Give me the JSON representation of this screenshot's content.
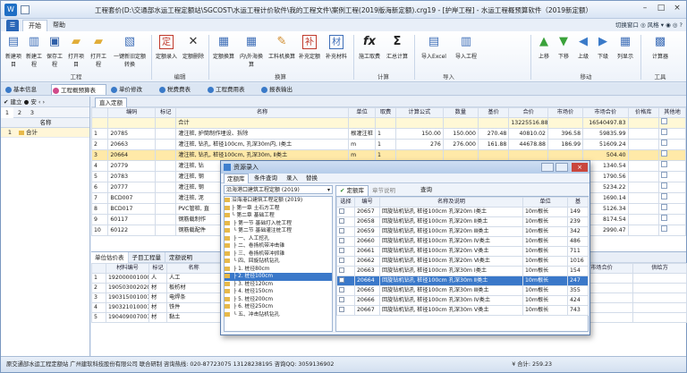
{
  "window": {
    "title": "工程套价(D:\\交通部水运工程定额站\\SGCOST\\水运工程计价软件\\我的工程文件\\案例工程(2019版海新定额).crg19 - [护岸工程] - 水运工程概预算软件（2019新定额）",
    "minimize": "–",
    "maximize": "□",
    "close": "×"
  },
  "menu": {
    "file": "☰",
    "tabs": [
      "开始",
      "帮助"
    ],
    "right": "切换窗口 ◎ 风格 ▾ ◉ ◎ ?"
  },
  "ribbon": {
    "groups": [
      {
        "label": "工程",
        "buttons": [
          "新建项目",
          "新建工程",
          "保存工程",
          "打开项目",
          "打开工程",
          "一键新旧定额转换"
        ]
      },
      {
        "label": "编辑",
        "buttons": [
          "定额录入",
          "定额删除"
        ]
      },
      {
        "label": "换算",
        "buttons": [
          "定额换算",
          "内\\外海换算",
          "工料机换算",
          "补充定额",
          "补充材料"
        ]
      },
      {
        "label": "计算",
        "buttons": [
          "施工取费",
          "汇总计算"
        ]
      },
      {
        "label": "导入",
        "buttons": [
          "导入Excel",
          "导入工程"
        ]
      },
      {
        "label": "移动",
        "buttons": [
          "上移",
          "下移",
          "上级",
          "下级",
          "列显示"
        ]
      },
      {
        "label": "工具",
        "buttons": [
          "计算器"
        ]
      }
    ]
  },
  "subtabs": [
    "基本信息",
    "工程概预算表",
    "单价修改",
    "税费费表",
    "工程费用表",
    "报表输出"
  ],
  "leftpane": {
    "toolbar": "✔ 建立  ● 安 ‹ ›",
    "level_tabs": [
      "1",
      "2",
      "3"
    ],
    "header": [
      "",
      "名称"
    ],
    "rows": [
      {
        "no": "1",
        "name": "合计"
      }
    ]
  },
  "maintable": {
    "tab": "直入定额",
    "headers": [
      "",
      "编码",
      "标记",
      "名称",
      "单位",
      "取费",
      "计算公式",
      "数量",
      "基价",
      "合价",
      "市场价",
      "市场合价",
      "价格库",
      "其他地"
    ],
    "rows": [
      {
        "no": "",
        "code": "",
        "mark": "",
        "name": "合计",
        "unit": "",
        "fee": "",
        "formula": "",
        "qty": "",
        "base": "",
        "total": "13225516.88",
        "market": "",
        "mtotal": "16540497.83",
        "lib": "",
        "cls": "hl"
      },
      {
        "no": "1",
        "code": "20785",
        "mark": "",
        "name": "灌注桩, 护筒制作埋设、拆除",
        "unit": "根灌注桩",
        "fee": "1",
        "formula": "150.00",
        "qty": "150.000",
        "base": "270.48",
        "total": "40810.02",
        "market": "396.58",
        "mtotal": "59835.99",
        "lib": "",
        "cls": ""
      },
      {
        "no": "2",
        "code": "20663",
        "mark": "",
        "name": "灌注桩, 钻孔, 桩径100cm, 孔深30m内, Ⅰ类土",
        "unit": "m",
        "fee": "1",
        "formula": "276",
        "qty": "276.000",
        "base": "161.88",
        "total": "44678.88",
        "market": "186.99",
        "mtotal": "51609.24",
        "lib": "",
        "cls": ""
      },
      {
        "no": "3",
        "code": "20664",
        "mark": "",
        "name": "灌注桩, 钻孔, 桩径100cm, 孔深30m, Ⅱ类土",
        "unit": "m",
        "fee": "1",
        "formula": "",
        "qty": "",
        "base": "",
        "total": "",
        "market": "",
        "mtotal": "504.40",
        "lib": "",
        "cls": "sel"
      },
      {
        "no": "4",
        "code": "20779",
        "mark": "",
        "name": "灌注桩, 钻",
        "unit": "",
        "fee": "",
        "formula": "",
        "qty": "",
        "base": "",
        "total": "",
        "market": "",
        "mtotal": "1340.54",
        "lib": "",
        "cls": ""
      },
      {
        "no": "5",
        "code": "20783",
        "mark": "",
        "name": "灌注桩, 钢",
        "unit": "",
        "fee": "",
        "formula": "",
        "qty": "",
        "base": "",
        "total": "",
        "market": "",
        "mtotal": "1790.56",
        "lib": "",
        "cls": ""
      },
      {
        "no": "6",
        "code": "20777",
        "mark": "",
        "name": "灌注桩, 钢",
        "unit": "",
        "fee": "",
        "formula": "",
        "qty": "",
        "base": "",
        "total": "",
        "market": "",
        "mtotal": "5234.22",
        "lib": "",
        "cls": ""
      },
      {
        "no": "7",
        "code": "BCD007",
        "mark": "",
        "name": "灌注桩, 泥",
        "unit": "",
        "fee": "",
        "formula": "",
        "qty": "",
        "base": "",
        "total": "",
        "market": "",
        "mtotal": "1690.14",
        "lib": "",
        "cls": ""
      },
      {
        "no": "8",
        "code": "BCD017",
        "mark": "",
        "name": "PVC管桩, 直",
        "unit": "",
        "fee": "",
        "formula": "",
        "qty": "",
        "base": "",
        "total": "",
        "market": "",
        "mtotal": "5126.34",
        "lib": "",
        "cls": ""
      },
      {
        "no": "9",
        "code": "60117",
        "mark": "",
        "name": "钢筋载制作",
        "unit": "",
        "fee": "",
        "formula": "",
        "qty": "",
        "base": "",
        "total": "",
        "market": "",
        "mtotal": "8174.54",
        "lib": "",
        "cls": ""
      },
      {
        "no": "10",
        "code": "60122",
        "mark": "",
        "name": "钢筋载配件",
        "unit": "",
        "fee": "",
        "formula": "",
        "qty": "",
        "base": "",
        "total": "",
        "market": "",
        "mtotal": "2990.47",
        "lib": "",
        "cls": ""
      }
    ]
  },
  "lowertable": {
    "tabs": [
      "单位估价表",
      "子目工程量",
      "定额说明"
    ],
    "headers": [
      "",
      "材料编号",
      "标记",
      "名称"
    ],
    "right_headers": [
      "市场合价",
      "供给方"
    ],
    "right_sub": "合价",
    "rows": [
      {
        "no": "1",
        "code": "192000001000",
        "mark": "人",
        "name": "人工"
      },
      {
        "no": "2",
        "code": "190503002020",
        "mark": "材",
        "name": "板枋材"
      },
      {
        "no": "3",
        "code": "190315001001",
        "mark": "材",
        "name": "电焊条"
      },
      {
        "no": "4",
        "code": "190321010001",
        "mark": "材",
        "name": "铁件"
      },
      {
        "no": "5",
        "code": "190409007001",
        "mark": "材",
        "name": "黏土"
      }
    ]
  },
  "dialog": {
    "title": "资源录入",
    "tabs": [
      "定额库",
      "条件查询",
      "录入",
      "替换"
    ],
    "library": "沿海港口建筑工程定额 (2019)",
    "right_tabs": [
      "定额库",
      "章节说明"
    ],
    "search_label": "查询",
    "tree": [
      "沿海港口建筑工程定额 (2019)",
      "├ 第一章 土石方工程",
      "└ 第二章 基础工程",
      "  ├ 第一节 基础打入桩工程",
      "  └ 第二节 基础灌注桩工程",
      "    ├ 一、人工挖孔",
      "    ├ 二、卷扬机带冲击锥",
      "    ├ 三、卷扬机带冲抓锥",
      "    └ 四、回旋钻机钻孔",
      "      ├ 1. 桩径80cm",
      "      ├ 2. 桩径100cm",
      "      ├ 3. 桩径120cm",
      "      ├ 4. 桩径150cm",
      "      ├ 5. 桩径200cm",
      "      ├ 6. 桩径250cm",
      "      └ 五、冲击钻机钻孔"
    ],
    "tree_selected": 10,
    "list_headers": [
      "选择",
      "编号",
      "名称及说明",
      "单位",
      "基"
    ],
    "list_rows": [
      {
        "code": "20657",
        "name": "回旋钻机钻孔 桩径100cm 孔深20m Ⅰ类土",
        "unit": "10m根长",
        "base": "149"
      },
      {
        "code": "20658",
        "name": "回旋钻机钻孔 桩径100cm 孔深20m Ⅱ类土",
        "unit": "10m根长",
        "base": "239"
      },
      {
        "code": "20659",
        "name": "回旋钻机钻孔 桩径100cm 孔深20m Ⅲ类土",
        "unit": "10m根长",
        "base": "342"
      },
      {
        "code": "20660",
        "name": "回旋钻机钻孔 桩径100cm 孔深20m Ⅳ类土",
        "unit": "10m根长",
        "base": "486"
      },
      {
        "code": "20661",
        "name": "回旋钻机钻孔 桩径100cm 孔深20m Ⅴ类土",
        "unit": "10m根长",
        "base": "711"
      },
      {
        "code": "20662",
        "name": "回旋钻机钻孔 桩径100cm 孔深20m Ⅵ类土",
        "unit": "10m根长",
        "base": "1016"
      },
      {
        "code": "20663",
        "name": "回旋钻机钻孔 桩径100cm 孔深30m Ⅰ类土",
        "unit": "10m根长",
        "base": "154"
      },
      {
        "code": "20664",
        "name": "回旋钻机钻孔 桩径100cm 孔深30m Ⅱ类土",
        "unit": "10m根长",
        "base": "247"
      },
      {
        "code": "20665",
        "name": "回旋钻机钻孔 桩径100cm 孔深30m Ⅲ类土",
        "unit": "10m根长",
        "base": "355"
      },
      {
        "code": "20666",
        "name": "回旋钻机钻孔 桩径100cm 孔深30m Ⅳ类土",
        "unit": "10m根长",
        "base": "424"
      },
      {
        "code": "20667",
        "name": "回旋钻机钻孔 桩径100cm 孔深30m Ⅴ类土",
        "unit": "10m根长",
        "base": "743"
      }
    ],
    "selected_row": 7
  },
  "status": {
    "left": "原交通部水运工程定额站  广州建软科技股份有限公司 联合研制  咨询热线: 020-87723075 13128238195  咨询QQ: 3059136902",
    "right": "¥ 合计: 259.23"
  }
}
